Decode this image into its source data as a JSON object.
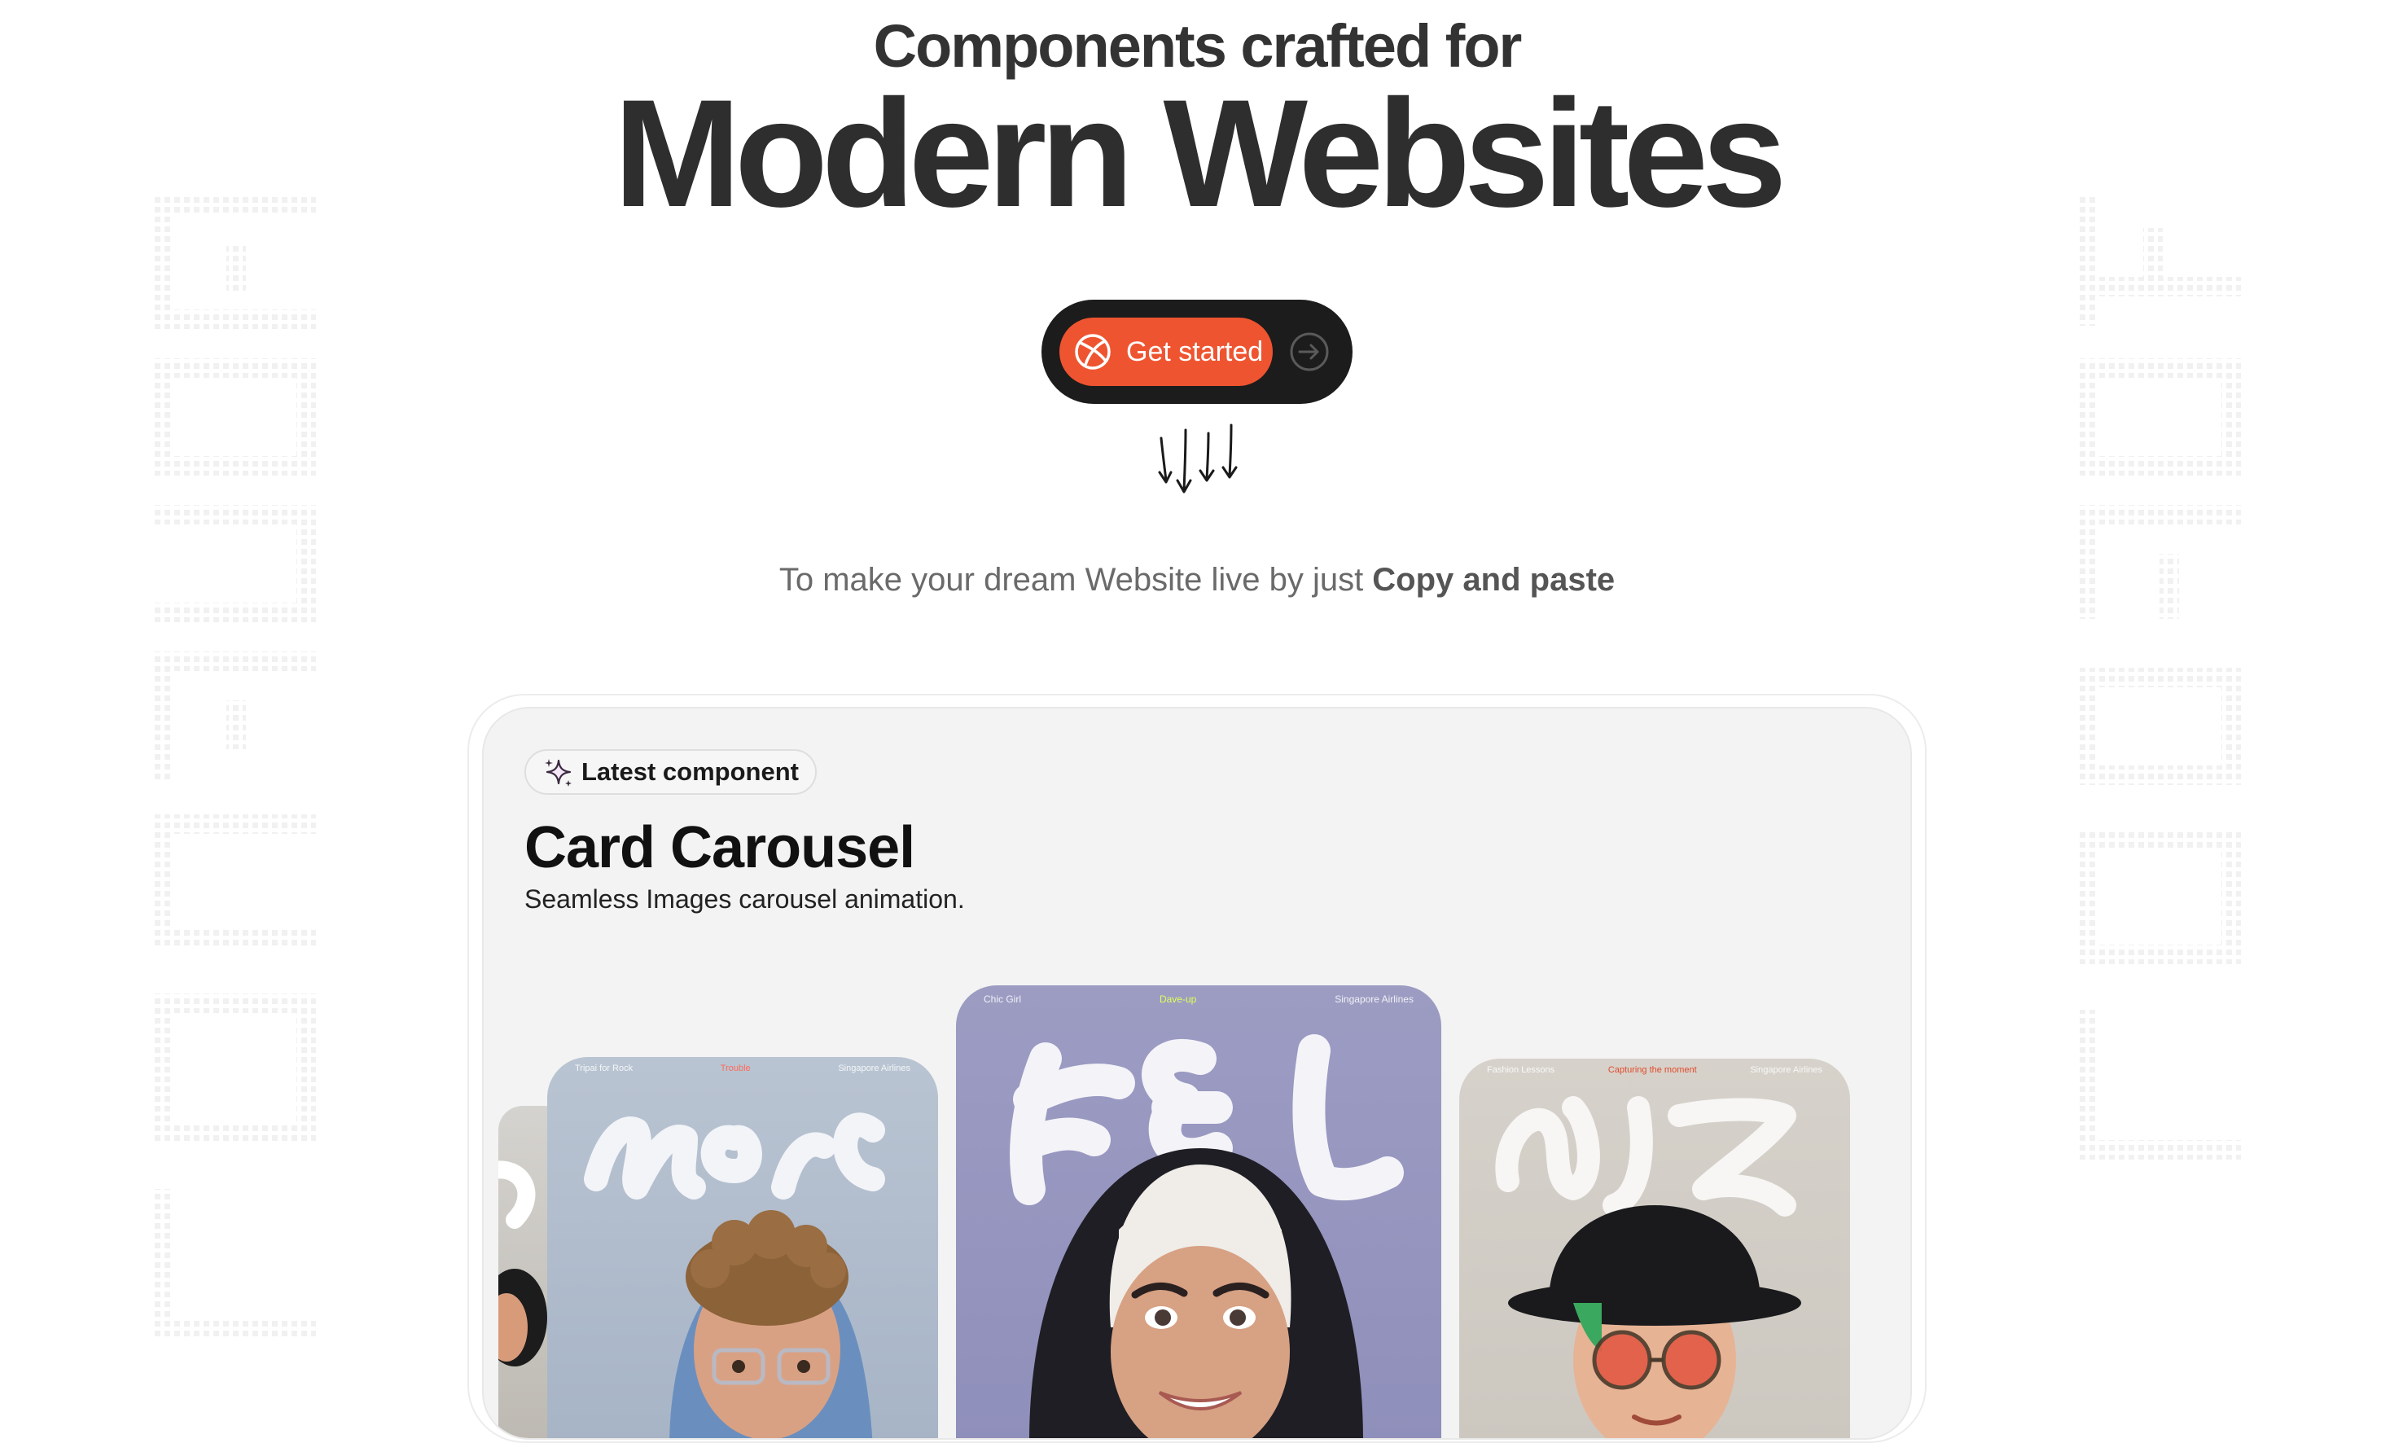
{
  "hero": {
    "subtitle": "Components crafted for",
    "title": "Modern Websites"
  },
  "cta": {
    "label": "Get started",
    "icon": "dribbble-ball-icon",
    "arrow_icon": "arrow-right-circle-icon",
    "color": "#ef5430"
  },
  "tagline": {
    "text": "To make your dream Website live by just ",
    "emphasis": "Copy and paste"
  },
  "side_text": {
    "left": "MINIMAL",
    "right": "LIBRARY"
  },
  "feature": {
    "badge": "Latest component",
    "badge_icon": "sparkles-icon",
    "title": "Card Carousel",
    "description": "Seamless Images carousel animation.",
    "cards": [
      {
        "word": "Marc",
        "meta_left": "Tripai for Rock",
        "meta_mid": "Trouble",
        "meta_right": "Singapore Airlines"
      },
      {
        "word": "FEL",
        "meta_left": "Chic Girl",
        "meta_mid": "Dave-up",
        "meta_right": "Singapore Airlines"
      },
      {
        "word": "AS",
        "meta_left": "Fashion Lessons",
        "meta_mid": "Capturing the moment",
        "meta_right": "Singapore Airlines"
      }
    ]
  }
}
